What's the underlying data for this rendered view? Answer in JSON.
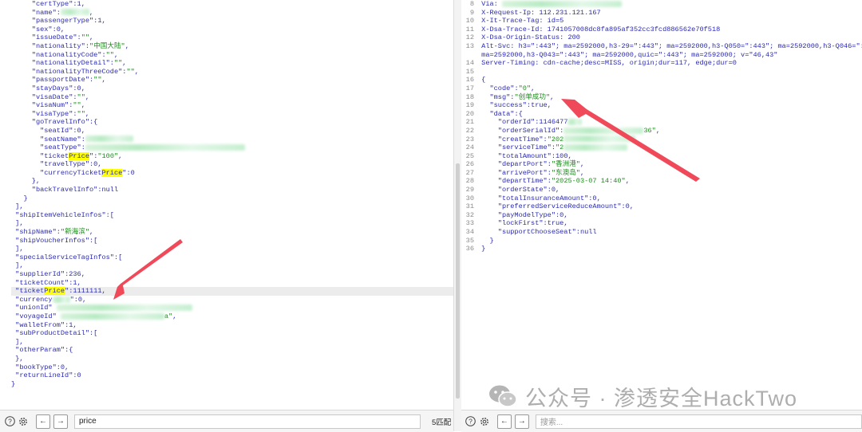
{
  "left": {
    "lines": [
      [
        {
          "t": "     "
        },
        {
          "t": "\"certType\"",
          "c": "k"
        },
        {
          "t": ":1,"
        }
      ],
      [
        {
          "t": "     "
        },
        {
          "t": "\"name\"",
          "c": "k"
        },
        {
          "t": ":"
        },
        {
          "b": "blur",
          "w": 36
        },
        {
          "t": ","
        }
      ],
      [
        {
          "t": "     "
        },
        {
          "t": "\"passengerType\"",
          "c": "k"
        },
        {
          "t": ":1,"
        }
      ],
      [
        {
          "t": "     "
        },
        {
          "t": "\"sex\"",
          "c": "k"
        },
        {
          "t": ":0,"
        }
      ],
      [
        {
          "t": "     "
        },
        {
          "t": "\"issueDate\"",
          "c": "k"
        },
        {
          "t": ":"
        },
        {
          "t": "\"\"",
          "c": "s"
        },
        {
          "t": ","
        }
      ],
      [
        {
          "t": "     "
        },
        {
          "t": "\"nationality\"",
          "c": "k"
        },
        {
          "t": ":"
        },
        {
          "t": "\"中国大陆\"",
          "c": "s"
        },
        {
          "t": ","
        }
      ],
      [
        {
          "t": "     "
        },
        {
          "t": "\"nationalityCode\"",
          "c": "k"
        },
        {
          "t": ":"
        },
        {
          "t": "\"\"",
          "c": "s"
        },
        {
          "t": ","
        }
      ],
      [
        {
          "t": "     "
        },
        {
          "t": "\"nationalityDetail\"",
          "c": "k"
        },
        {
          "t": ":"
        },
        {
          "t": "\"\"",
          "c": "s"
        },
        {
          "t": ","
        }
      ],
      [
        {
          "t": "     "
        },
        {
          "t": "\"nationalityThreeCode\"",
          "c": "k"
        },
        {
          "t": ":"
        },
        {
          "t": "\"\"",
          "c": "s"
        },
        {
          "t": ","
        }
      ],
      [
        {
          "t": "     "
        },
        {
          "t": "\"passportDate\"",
          "c": "k"
        },
        {
          "t": ":"
        },
        {
          "t": "\"\"",
          "c": "s"
        },
        {
          "t": ","
        }
      ],
      [
        {
          "t": "     "
        },
        {
          "t": "\"stayDays\"",
          "c": "k"
        },
        {
          "t": ":0,"
        }
      ],
      [
        {
          "t": "     "
        },
        {
          "t": "\"visaDate\"",
          "c": "k"
        },
        {
          "t": ":"
        },
        {
          "t": "\"\"",
          "c": "s"
        },
        {
          "t": ","
        }
      ],
      [
        {
          "t": "     "
        },
        {
          "t": "\"visaNum\"",
          "c": "k"
        },
        {
          "t": ":"
        },
        {
          "t": "\"\"",
          "c": "s"
        },
        {
          "t": ","
        }
      ],
      [
        {
          "t": "     "
        },
        {
          "t": "\"visaType\"",
          "c": "k"
        },
        {
          "t": ":"
        },
        {
          "t": "\"\"",
          "c": "s"
        },
        {
          "t": ","
        }
      ],
      [
        {
          "t": "     "
        },
        {
          "t": "\"goTravelInfo\"",
          "c": "k"
        },
        {
          "t": ":{"
        }
      ],
      [
        {
          "t": "       "
        },
        {
          "t": "\"seatId\"",
          "c": "k"
        },
        {
          "t": ":0,"
        }
      ],
      [
        {
          "t": "       "
        },
        {
          "t": "\"seatName\"",
          "c": "k"
        },
        {
          "t": ":"
        },
        {
          "b": "blur",
          "w": 60
        }
      ],
      [
        {
          "t": "       "
        },
        {
          "t": "\"seatType\"",
          "c": "k"
        },
        {
          "t": ":"
        },
        {
          "b": "blur",
          "w": 200
        }
      ],
      [
        {
          "t": "       "
        },
        {
          "t": "\"ticket",
          "c": "k"
        },
        {
          "t": "Price",
          "c": "mark"
        },
        {
          "t": "\"",
          "c": "k"
        },
        {
          "t": ":"
        },
        {
          "t": "\"100\"",
          "c": "s"
        },
        {
          "t": ","
        }
      ],
      [
        {
          "t": "       "
        },
        {
          "t": "\"travelType\"",
          "c": "k"
        },
        {
          "t": ":0,"
        }
      ],
      [
        {
          "t": "       "
        },
        {
          "t": "\"currencyTicket",
          "c": "k"
        },
        {
          "t": "Price",
          "c": "mark"
        },
        {
          "t": "\"",
          "c": "k"
        },
        {
          "t": ":0"
        }
      ],
      [
        {
          "t": "     },"
        }
      ],
      [
        {
          "t": "     "
        },
        {
          "t": "\"backTravelInfo\"",
          "c": "k"
        },
        {
          "t": ":null"
        }
      ],
      [
        {
          "t": "   }"
        }
      ],
      [
        {
          "t": " ],"
        }
      ],
      [
        {
          "t": " "
        },
        {
          "t": "\"shipItemVehicleInfos\"",
          "c": "k"
        },
        {
          "t": ":["
        }
      ],
      [
        {
          "t": " ],"
        }
      ],
      [
        {
          "t": " "
        },
        {
          "t": "\"shipName\"",
          "c": "k"
        },
        {
          "t": ":"
        },
        {
          "t": "\"新海滨\"",
          "c": "s"
        },
        {
          "t": ","
        }
      ],
      [
        {
          "t": " "
        },
        {
          "t": "\"shipVoucherInfos\"",
          "c": "k"
        },
        {
          "t": ":["
        }
      ],
      [
        {
          "t": " ],"
        }
      ],
      [
        {
          "t": " "
        },
        {
          "t": "\"specialServiceTagInfos\"",
          "c": "k"
        },
        {
          "t": ":["
        }
      ],
      [
        {
          "t": " ],"
        }
      ],
      [
        {
          "t": " "
        },
        {
          "t": "\"supplierId\"",
          "c": "k"
        },
        {
          "t": ":236,"
        }
      ],
      [
        {
          "t": " "
        },
        {
          "t": "\"ticketCount\"",
          "c": "k"
        },
        {
          "t": ":1,"
        }
      ],
      [
        {
          "t": " "
        },
        {
          "t": "\"ticket",
          "c": "k"
        },
        {
          "t": "Price",
          "c": "mark"
        },
        {
          "t": "\"",
          "c": "k"
        },
        {
          "t": ":1111111,"
        }
      ],
      [
        {
          "t": " "
        },
        {
          "t": "\"currency",
          "c": "k"
        },
        {
          "b": "blur",
          "w": 22
        },
        {
          "t": "\"",
          "c": "k"
        },
        {
          "t": ":0,"
        }
      ],
      [
        {
          "t": " "
        },
        {
          "t": "\"unionId\"",
          "c": "k"
        },
        {
          "t": " "
        },
        {
          "b": "blur",
          "w": 170
        }
      ],
      [
        {
          "t": " "
        },
        {
          "t": "\"voyageId\"",
          "c": "k"
        },
        {
          "t": " "
        },
        {
          "b": "blur",
          "w": 130
        },
        {
          "t": "a\"",
          "c": "s"
        },
        {
          "t": ","
        }
      ],
      [
        {
          "t": " "
        },
        {
          "t": "\"walletFrom\"",
          "c": "k"
        },
        {
          "t": ":1,"
        }
      ],
      [
        {
          "t": " "
        },
        {
          "t": "\"subProductDetail\"",
          "c": "k"
        },
        {
          "t": ":["
        }
      ],
      [
        {
          "t": " ],"
        }
      ],
      [
        {
          "t": " "
        },
        {
          "t": "\"otherParam\"",
          "c": "k"
        },
        {
          "t": ":{"
        }
      ],
      [
        {
          "t": " },"
        }
      ],
      [
        {
          "t": " "
        },
        {
          "t": "\"bookType\"",
          "c": "k"
        },
        {
          "t": ":0,"
        }
      ],
      [
        {
          "t": " "
        },
        {
          "t": "\"returnLineId\"",
          "c": "k"
        },
        {
          "t": ":0"
        }
      ],
      [
        {
          "t": "}"
        }
      ]
    ],
    "search_value": "price",
    "match_count": "5匹配"
  },
  "right": {
    "lines": [
      [
        {
          "n": "8"
        },
        {
          "t": " Via: "
        },
        {
          "b": "blur",
          "w": 150
        }
      ],
      [
        {
          "n": "9"
        },
        {
          "t": " X-Request-Ip: 112.231.121.167"
        }
      ],
      [
        {
          "n": "10"
        },
        {
          "t": " X-It-Trace-Tag: id=5"
        }
      ],
      [
        {
          "n": "11"
        },
        {
          "t": " X-Dsa-Trace-Id: 1741057008dc8fa895af352cc3fcd886562e70f518"
        }
      ],
      [
        {
          "n": "12"
        },
        {
          "t": " X-Dsa-Origin-Status: 200"
        }
      ],
      [
        {
          "n": "13"
        },
        {
          "t": " Alt-Svc: h3=\":443\"; ma=2592000,h3-29=\":443\"; ma=2592000,h3-Q050=\":443\"; ma=2592000,h3-Q046=\":4"
        }
      ],
      [
        {
          "n": ""
        },
        {
          "t": " ma=2592000,h3-Q043=\":443\"; ma=2592000,quic=\":443\"; ma=2592000; v=\"46,43\""
        }
      ],
      [
        {
          "n": "14"
        },
        {
          "t": " Server-Timing: cdn-cache;desc=MISS, origin;dur=117, edge;dur=0"
        }
      ],
      [
        {
          "n": "15"
        },
        {
          "t": ""
        }
      ],
      [
        {
          "n": "16"
        },
        {
          "t": " {"
        }
      ],
      [
        {
          "n": "17"
        },
        {
          "t": "   "
        },
        {
          "t": "\"code\"",
          "c": "k"
        },
        {
          "t": ":"
        },
        {
          "t": "\"0\"",
          "c": "s"
        },
        {
          "t": ","
        }
      ],
      [
        {
          "n": "18"
        },
        {
          "t": "   "
        },
        {
          "t": "\"msg\"",
          "c": "k"
        },
        {
          "t": ":"
        },
        {
          "t": "\"创单成功\"",
          "c": "s"
        },
        {
          "t": ","
        }
      ],
      [
        {
          "n": "19"
        },
        {
          "t": "   "
        },
        {
          "t": "\"success\"",
          "c": "k"
        },
        {
          "t": ":true,"
        }
      ],
      [
        {
          "n": "20"
        },
        {
          "t": "   "
        },
        {
          "t": "\"data\"",
          "c": "k"
        },
        {
          "t": ":{"
        }
      ],
      [
        {
          "n": "21"
        },
        {
          "t": "     "
        },
        {
          "t": "\"orderId\"",
          "c": "k"
        },
        {
          "t": ":1146477"
        },
        {
          "b": "blur",
          "w": 18
        }
      ],
      [
        {
          "n": "22"
        },
        {
          "t": "     "
        },
        {
          "t": "\"orderSerialId\"",
          "c": "k"
        },
        {
          "t": ":"
        },
        {
          "b": "blur",
          "w": 100
        },
        {
          "t": "36\"",
          "c": "s"
        },
        {
          "t": ","
        }
      ],
      [
        {
          "n": "23"
        },
        {
          "t": "     "
        },
        {
          "t": "\"creatTime\"",
          "c": "k"
        },
        {
          "t": ":"
        },
        {
          "t": "\"202",
          "c": "s"
        },
        {
          "b": "blur",
          "w": 90
        }
      ],
      [
        {
          "n": "24"
        },
        {
          "t": "     "
        },
        {
          "t": "\"serviceTime\"",
          "c": "k"
        },
        {
          "t": ":"
        },
        {
          "t": "\"2",
          "c": "s"
        },
        {
          "b": "blur",
          "w": 80
        }
      ],
      [
        {
          "n": "25"
        },
        {
          "t": "     "
        },
        {
          "t": "\"totalAmount\"",
          "c": "k"
        },
        {
          "t": ":100,"
        }
      ],
      [
        {
          "n": "26"
        },
        {
          "t": "     "
        },
        {
          "t": "\"departPort\"",
          "c": "k"
        },
        {
          "t": ":"
        },
        {
          "t": "\"香洲港\"",
          "c": "s"
        },
        {
          "t": ","
        }
      ],
      [
        {
          "n": "27"
        },
        {
          "t": "     "
        },
        {
          "t": "\"arrivePort\"",
          "c": "k"
        },
        {
          "t": ":"
        },
        {
          "t": "\"东澳岛\"",
          "c": "s"
        },
        {
          "t": ","
        }
      ],
      [
        {
          "n": "28"
        },
        {
          "t": "     "
        },
        {
          "t": "\"departTime\"",
          "c": "k"
        },
        {
          "t": ":"
        },
        {
          "t": "\"2025-03-07 14:40\"",
          "c": "s"
        },
        {
          "t": ","
        }
      ],
      [
        {
          "n": "29"
        },
        {
          "t": "     "
        },
        {
          "t": "\"orderState\"",
          "c": "k"
        },
        {
          "t": ":0,"
        }
      ],
      [
        {
          "n": "30"
        },
        {
          "t": "     "
        },
        {
          "t": "\"totalInsuranceAmount\"",
          "c": "k"
        },
        {
          "t": ":0,"
        }
      ],
      [
        {
          "n": "31"
        },
        {
          "t": "     "
        },
        {
          "t": "\"preferredServiceReduceAmount\"",
          "c": "k"
        },
        {
          "t": ":0,"
        }
      ],
      [
        {
          "n": "32"
        },
        {
          "t": "     "
        },
        {
          "t": "\"payModelType\"",
          "c": "k"
        },
        {
          "t": ":0,"
        }
      ],
      [
        {
          "n": "33"
        },
        {
          "t": "     "
        },
        {
          "t": "\"lockFirst\"",
          "c": "k"
        },
        {
          "t": ":true,"
        }
      ],
      [
        {
          "n": "34"
        },
        {
          "t": "     "
        },
        {
          "t": "\"supportChooseSeat\"",
          "c": "k"
        },
        {
          "t": ":null"
        }
      ],
      [
        {
          "n": "35"
        },
        {
          "t": "   }"
        }
      ],
      [
        {
          "n": "36"
        },
        {
          "t": " }"
        }
      ]
    ],
    "search_placeholder": "搜索..."
  },
  "watermark": "公众号 · 渗透安全HackTwo",
  "icons": {
    "help": "help-icon",
    "settings": "gear-icon",
    "prev": "arrow-left-icon",
    "next": "arrow-right-icon"
  },
  "colors": {
    "key": "#2b2bb0",
    "string": "#1f8a1f",
    "highlight": "#ffff00",
    "arrow": "#f04a5a"
  }
}
